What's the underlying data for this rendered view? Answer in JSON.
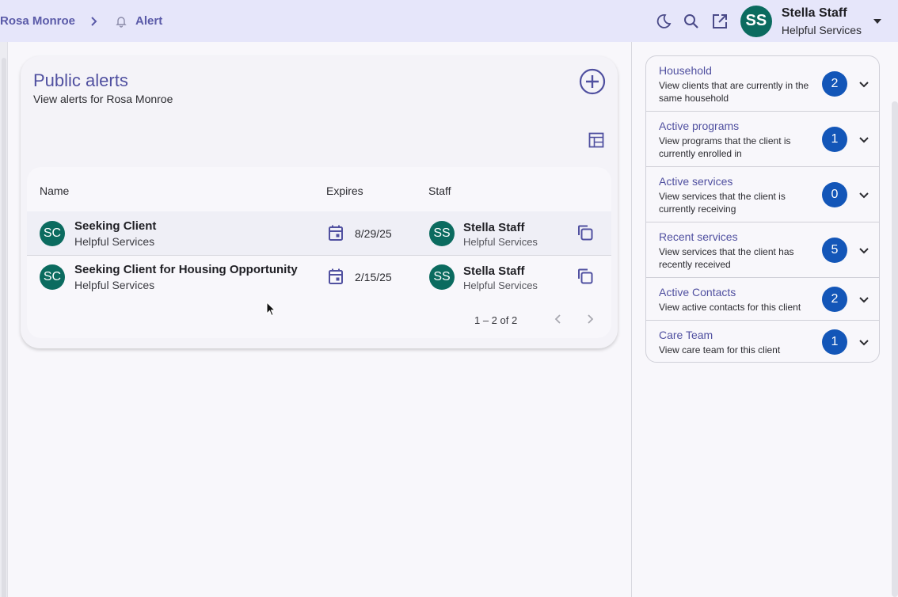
{
  "breadcrumb": {
    "client": "Rosa Monroe",
    "current": "Alert"
  },
  "user": {
    "initials": "SS",
    "name": "Stella Staff",
    "org": "Helpful Services"
  },
  "card": {
    "title": "Public alerts",
    "subtitle": "View alerts for Rosa Monroe",
    "columns": {
      "name": "Name",
      "expires": "Expires",
      "staff": "Staff"
    },
    "rows": [
      {
        "initials": "SC",
        "name": "Seeking Client",
        "org": "Helpful Services",
        "expires": "8/29/25",
        "staff_initials": "SS",
        "staff_name": "Stella Staff",
        "staff_org": "Helpful Services"
      },
      {
        "initials": "SC",
        "name": "Seeking Client for Housing Opportunity",
        "org": "Helpful Services",
        "expires": "2/15/25",
        "staff_initials": "SS",
        "staff_name": "Stella Staff",
        "staff_org": "Helpful Services"
      }
    ],
    "pagination": "1 – 2 of 2"
  },
  "panel": {
    "items": [
      {
        "title": "Household",
        "desc": "View clients that are currently in the same household",
        "count": "2"
      },
      {
        "title": "Active programs",
        "desc": "View programs that the client is currently enrolled in",
        "count": "1"
      },
      {
        "title": "Active services",
        "desc": "View services that the client is currently receiving",
        "count": "0"
      },
      {
        "title": "Recent services",
        "desc": "View services that the client has recently received",
        "count": "5"
      },
      {
        "title": "Active Contacts",
        "desc": "View active contacts for this client",
        "count": "2"
      },
      {
        "title": "Care Team",
        "desc": "View care team for this client",
        "count": "1"
      }
    ]
  },
  "colors": {
    "accent": "#5050a0",
    "avatar": "#0b6b5f",
    "badge": "#1356b8",
    "topbar": "#e6e6fa"
  }
}
